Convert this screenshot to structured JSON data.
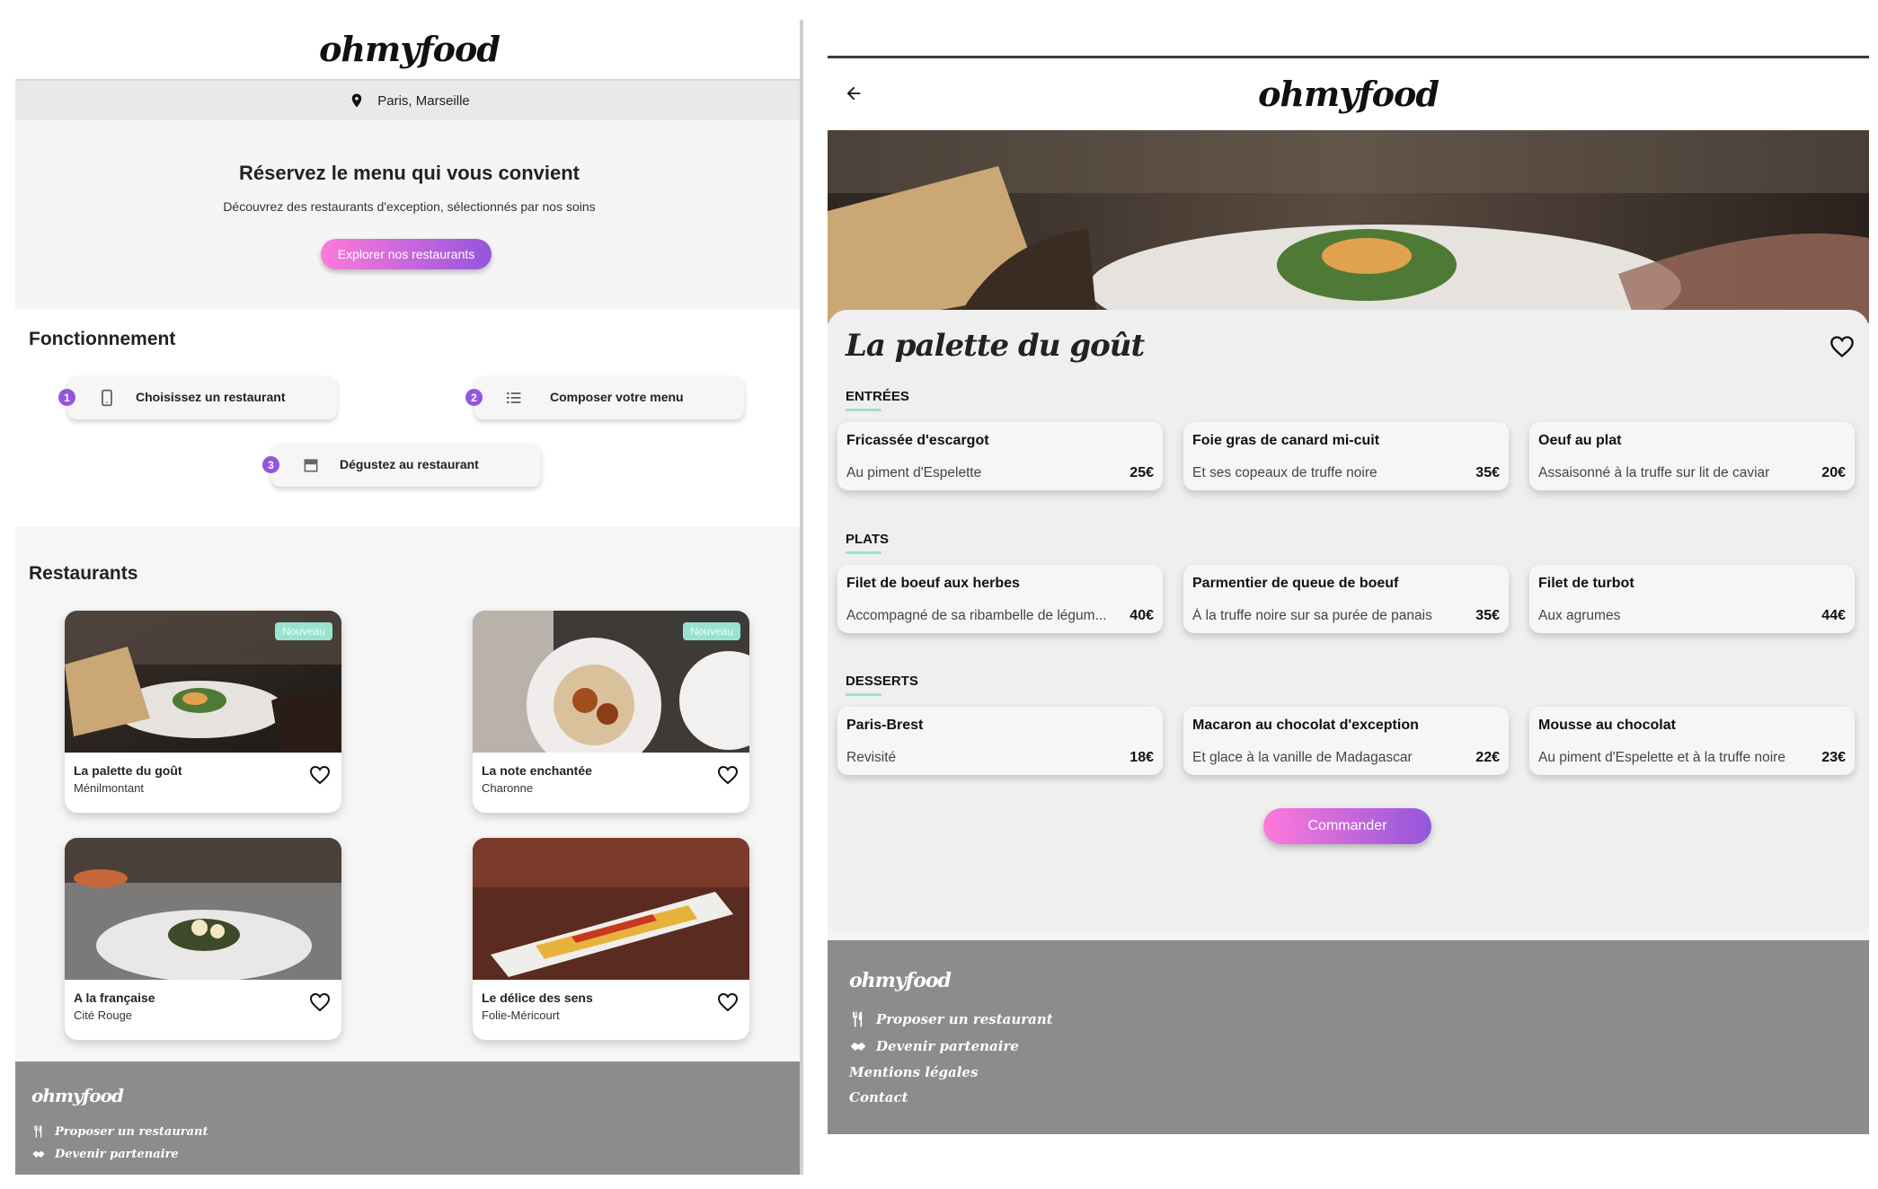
{
  "brand": "ohmyfood",
  "left": {
    "location": "Paris, Marseille",
    "hero": {
      "title": "Réservez le menu qui vous convient",
      "subtitle": "Découvrez des restaurants d'exception, sélectionnés par nos soins",
      "cta": "Explorer nos restaurants"
    },
    "how": {
      "title": "Fonctionnement",
      "steps": [
        {
          "num": "1",
          "label": "Choisissez un restaurant",
          "icon": "phone-icon"
        },
        {
          "num": "2",
          "label": "Composer votre menu",
          "icon": "list-icon"
        },
        {
          "num": "3",
          "label": "Dégustez au restaurant",
          "icon": "store-icon"
        }
      ]
    },
    "restaurants": {
      "title": "Restaurants",
      "badge": "Nouveau",
      "items": [
        {
          "name": "La palette du goût",
          "area": "Ménilmontant",
          "new": true
        },
        {
          "name": "La note enchantée",
          "area": "Charonne",
          "new": true
        },
        {
          "name": "A la française",
          "area": "Cité Rouge",
          "new": false
        },
        {
          "name": "Le délice des sens",
          "area": "Folie-Méricourt",
          "new": false
        }
      ]
    },
    "footer": {
      "brand": "ohmyfood",
      "links": [
        "Proposer un restaurant",
        "Devenir partenaire"
      ]
    }
  },
  "right": {
    "title": "La palette du goût",
    "sections": [
      {
        "name": "ENTRÉES",
        "dishes": [
          {
            "name": "Fricassée d'escargot",
            "desc": "Au piment d'Espelette",
            "price": "25€"
          },
          {
            "name": "Foie gras de canard mi-cuit",
            "desc": "Et ses copeaux de truffe noire",
            "price": "35€"
          },
          {
            "name": "Oeuf au plat",
            "desc": "Assaisonné à la truffe sur lit de caviar",
            "price": "20€"
          }
        ]
      },
      {
        "name": "PLATS",
        "dishes": [
          {
            "name": "Filet de boeuf aux herbes",
            "desc": "Accompagné de sa ribambelle de légum...",
            "price": "40€"
          },
          {
            "name": "Parmentier de queue de boeuf",
            "desc": "À la truffe noire sur sa purée de panais",
            "price": "35€"
          },
          {
            "name": "Filet de turbot",
            "desc": "Aux agrumes",
            "price": "44€"
          }
        ]
      },
      {
        "name": "DESSERTS",
        "dishes": [
          {
            "name": "Paris-Brest",
            "desc": "Revisité",
            "price": "18€"
          },
          {
            "name": "Macaron au chocolat d'exception",
            "desc": "Et glace à la vanille de Madagascar",
            "price": "22€"
          },
          {
            "name": "Mousse au chocolat",
            "desc": "Au piment d'Espelette et à la truffe noire",
            "price": "23€"
          }
        ]
      }
    ],
    "order": "Commander",
    "footer": {
      "brand": "ohmyfood",
      "links": [
        "Proposer un restaurant",
        "Devenir partenaire",
        "Mentions légales",
        "Contact"
      ]
    }
  },
  "colors": {
    "gradient_start": "#ff79da",
    "gradient_end": "#9356dc",
    "accent": "#99e2d0",
    "footer": "#8c8c8c"
  }
}
